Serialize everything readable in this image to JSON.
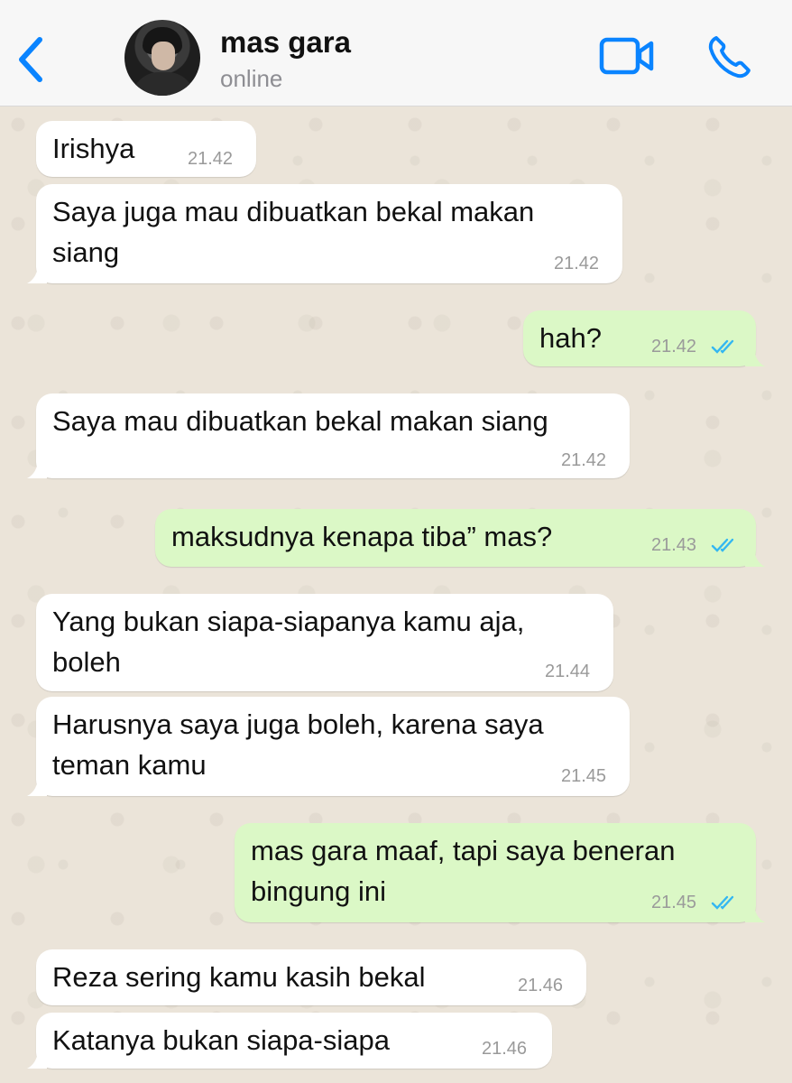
{
  "header": {
    "contact_name": "mas gara",
    "status": "online",
    "back_icon": "chevron-left-icon",
    "video_icon": "video-camera-icon",
    "phone_icon": "phone-icon",
    "accent_color": "#0a84ff"
  },
  "colors": {
    "incoming_bubble": "#ffffff",
    "outgoing_bubble": "#dbf8c6",
    "read_ticks": "#34b7f1"
  },
  "messages": [
    {
      "direction": "incoming",
      "text": "Irishya",
      "time": "21.42"
    },
    {
      "direction": "incoming",
      "text": "Saya juga mau dibuatkan bekal makan siang",
      "time": "21.42"
    },
    {
      "direction": "outgoing",
      "text": "hah?",
      "time": "21.42",
      "status": "read"
    },
    {
      "direction": "incoming",
      "text": "Saya mau dibuatkan bekal makan siang",
      "time": "21.42"
    },
    {
      "direction": "outgoing",
      "text": "maksudnya kenapa tiba” mas?",
      "time": "21.43",
      "status": "read"
    },
    {
      "direction": "incoming",
      "text": "Yang bukan siapa-siapanya kamu aja, boleh",
      "time": "21.44"
    },
    {
      "direction": "incoming",
      "text": "Harusnya saya juga boleh, karena saya teman kamu",
      "time": "21.45"
    },
    {
      "direction": "outgoing",
      "text": "mas gara maaf, tapi saya beneran bingung ini",
      "time": "21.45",
      "status": "read"
    },
    {
      "direction": "incoming",
      "text": "Reza sering kamu kasih bekal",
      "time": "21.46"
    },
    {
      "direction": "incoming",
      "text": "Katanya bukan siapa-siapa",
      "time": "21.46"
    }
  ]
}
